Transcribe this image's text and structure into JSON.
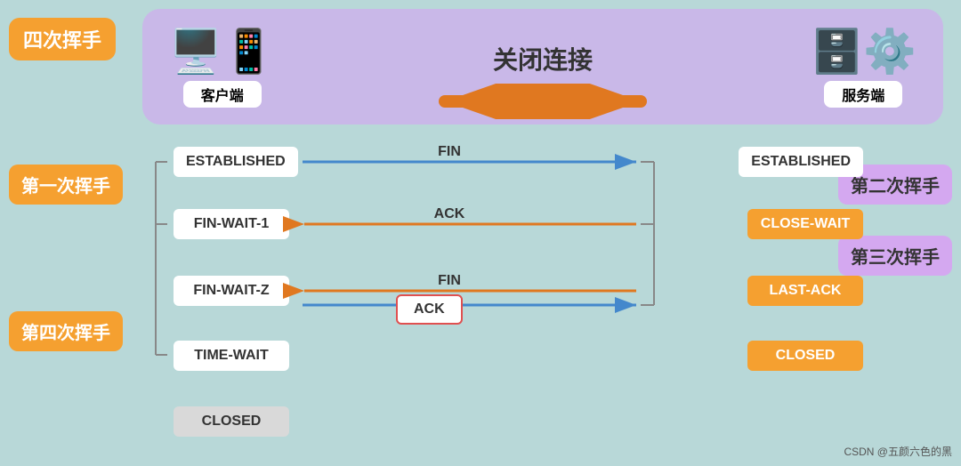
{
  "top": {
    "label": "四次挥手",
    "connection_label": "关闭连接",
    "client_label": "客户端",
    "server_label": "服务端"
  },
  "states": {
    "left": {
      "established": "ESTABLISHED",
      "fin_wait_1": "FIN-WAIT-1",
      "fin_wait_2": "FIN-WAIT-Z",
      "time_wait": "TIME-WAIT",
      "closed_bottom": "CLOSED"
    },
    "right": {
      "established": "ESTABLISHED",
      "close_wait": "CLOSE-WAIT",
      "last_ack": "LAST-ACK",
      "closed": "CLOSED"
    }
  },
  "signals": {
    "fin1": "FIN",
    "ack1": "ACK",
    "fin2": "FIN",
    "ack2": "ACK"
  },
  "side_labels": {
    "first": "第一次挥手",
    "second": "第二次挥手",
    "third": "第三次挥手",
    "fourth": "第四次挥手"
  },
  "watermark": "CSDN @五颜六色的黑"
}
